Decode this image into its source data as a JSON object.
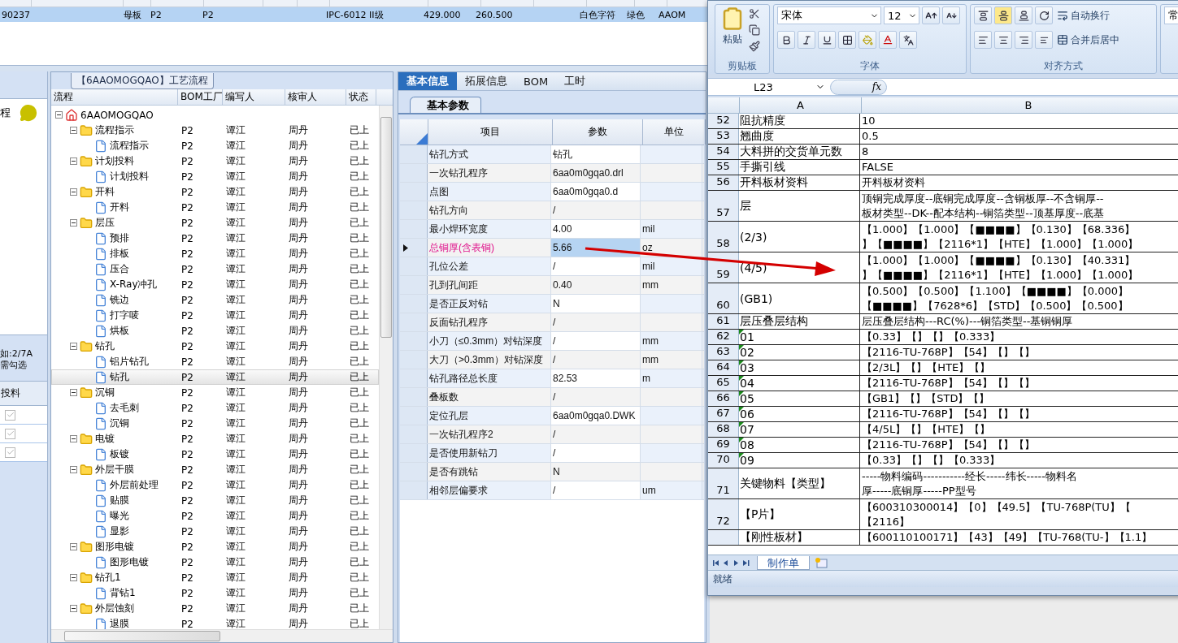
{
  "top_grid": {
    "rows": [
      {
        "selected": true,
        "cells": [
          "90237",
          "母板",
          "P2",
          "P2",
          "IPC-6012 II级",
          "429.000",
          "260.500",
          "白色字符",
          "绿色",
          "AAOM"
        ]
      }
    ]
  },
  "left_panel": {
    "heading": "程",
    "hint_lines": [
      "如:2/7A",
      "需勾选"
    ],
    "column": "投料",
    "rows": [
      {
        "checked": true,
        "disabled": true
      },
      {
        "checked": true,
        "disabled": true
      },
      {
        "checked": true,
        "disabled": true
      }
    ]
  },
  "process_tree": {
    "caption": "【6AAOMOGQAO】工艺流程",
    "columns": [
      "流程",
      "BOM工厂",
      "编写人",
      "核审人",
      "状态"
    ],
    "nodes": [
      {
        "label": "6AAOMOGQAO",
        "kind": "root",
        "expanded": true,
        "selected": false,
        "children": [
          {
            "label": "流程指示",
            "kind": "folder",
            "expanded": true,
            "selected": false,
            "factory": "P2",
            "writer": "谭江",
            "reviewer": "周丹",
            "status": "已上",
            "children": [
              {
                "label": "流程指示",
                "kind": "file",
                "selected": false,
                "factory": "P2",
                "writer": "谭江",
                "reviewer": "周丹",
                "status": "已上"
              }
            ]
          },
          {
            "label": "计划投料",
            "kind": "folder",
            "expanded": true,
            "selected": false,
            "factory": "P2",
            "writer": "谭江",
            "reviewer": "周丹",
            "status": "已上",
            "children": [
              {
                "label": "计划投料",
                "kind": "file",
                "selected": false,
                "factory": "P2",
                "writer": "谭江",
                "reviewer": "周丹",
                "status": "已上"
              }
            ]
          },
          {
            "label": "开料",
            "kind": "folder",
            "expanded": true,
            "selected": false,
            "factory": "P2",
            "writer": "谭江",
            "reviewer": "周丹",
            "status": "已上",
            "children": [
              {
                "label": "开料",
                "kind": "file",
                "selected": false,
                "factory": "P2",
                "writer": "谭江",
                "reviewer": "周丹",
                "status": "已上"
              }
            ]
          },
          {
            "label": "层压",
            "kind": "folder",
            "expanded": true,
            "selected": false,
            "factory": "P2",
            "writer": "谭江",
            "reviewer": "周丹",
            "status": "已上",
            "children": [
              {
                "label": "预排",
                "kind": "file",
                "selected": false,
                "factory": "P2",
                "writer": "谭江",
                "reviewer": "周丹",
                "status": "已上"
              },
              {
                "label": "排板",
                "kind": "file",
                "selected": false,
                "factory": "P2",
                "writer": "谭江",
                "reviewer": "周丹",
                "status": "已上"
              },
              {
                "label": "压合",
                "kind": "file",
                "selected": false,
                "factory": "P2",
                "writer": "谭江",
                "reviewer": "周丹",
                "status": "已上"
              },
              {
                "label": "X-Ray冲孔",
                "kind": "file",
                "selected": false,
                "factory": "P2",
                "writer": "谭江",
                "reviewer": "周丹",
                "status": "已上"
              },
              {
                "label": "铣边",
                "kind": "file",
                "selected": false,
                "factory": "P2",
                "writer": "谭江",
                "reviewer": "周丹",
                "status": "已上"
              },
              {
                "label": "打字唛",
                "kind": "file",
                "selected": false,
                "factory": "P2",
                "writer": "谭江",
                "reviewer": "周丹",
                "status": "已上"
              },
              {
                "label": "烘板",
                "kind": "file",
                "selected": false,
                "factory": "P2",
                "writer": "谭江",
                "reviewer": "周丹",
                "status": "已上"
              }
            ]
          },
          {
            "label": "钻孔",
            "kind": "folder",
            "expanded": true,
            "selected": false,
            "factory": "P2",
            "writer": "谭江",
            "reviewer": "周丹",
            "status": "已上",
            "children": [
              {
                "label": "铝片钻孔",
                "kind": "file",
                "selected": false,
                "factory": "P2",
                "writer": "谭江",
                "reviewer": "周丹",
                "status": "已上"
              },
              {
                "label": "钻孔",
                "kind": "file",
                "selected": true,
                "factory": "P2",
                "writer": "谭江",
                "reviewer": "周丹",
                "status": "已上"
              }
            ]
          },
          {
            "label": "沉铜",
            "kind": "folder",
            "expanded": true,
            "selected": false,
            "factory": "P2",
            "writer": "谭江",
            "reviewer": "周丹",
            "status": "已上",
            "children": [
              {
                "label": "去毛刺",
                "kind": "file",
                "selected": false,
                "factory": "P2",
                "writer": "谭江",
                "reviewer": "周丹",
                "status": "已上"
              },
              {
                "label": "沉铜",
                "kind": "file",
                "selected": false,
                "factory": "P2",
                "writer": "谭江",
                "reviewer": "周丹",
                "status": "已上"
              }
            ]
          },
          {
            "label": "电镀",
            "kind": "folder",
            "expanded": true,
            "selected": false,
            "factory": "P2",
            "writer": "谭江",
            "reviewer": "周丹",
            "status": "已上",
            "children": [
              {
                "label": "板镀",
                "kind": "file",
                "selected": false,
                "factory": "P2",
                "writer": "谭江",
                "reviewer": "周丹",
                "status": "已上"
              }
            ]
          },
          {
            "label": "外层干膜",
            "kind": "folder",
            "expanded": true,
            "selected": false,
            "factory": "P2",
            "writer": "谭江",
            "reviewer": "周丹",
            "status": "已上",
            "children": [
              {
                "label": "外层前处理",
                "kind": "file",
                "selected": false,
                "factory": "P2",
                "writer": "谭江",
                "reviewer": "周丹",
                "status": "已上"
              },
              {
                "label": "贴膜",
                "kind": "file",
                "selected": false,
                "factory": "P2",
                "writer": "谭江",
                "reviewer": "周丹",
                "status": "已上"
              },
              {
                "label": "曝光",
                "kind": "file",
                "selected": false,
                "factory": "P2",
                "writer": "谭江",
                "reviewer": "周丹",
                "status": "已上"
              },
              {
                "label": "显影",
                "kind": "file",
                "selected": false,
                "factory": "P2",
                "writer": "谭江",
                "reviewer": "周丹",
                "status": "已上"
              }
            ]
          },
          {
            "label": "图形电镀",
            "kind": "folder",
            "expanded": true,
            "selected": false,
            "factory": "P2",
            "writer": "谭江",
            "reviewer": "周丹",
            "status": "已上",
            "children": [
              {
                "label": "图形电镀",
                "kind": "file",
                "selected": false,
                "factory": "P2",
                "writer": "谭江",
                "reviewer": "周丹",
                "status": "已上"
              }
            ]
          },
          {
            "label": "钻孔1",
            "kind": "folder",
            "expanded": true,
            "selected": false,
            "factory": "P2",
            "writer": "谭江",
            "reviewer": "周丹",
            "status": "已上",
            "children": [
              {
                "label": "背钻1",
                "kind": "file",
                "selected": false,
                "factory": "P2",
                "writer": "谭江",
                "reviewer": "周丹",
                "status": "已上"
              }
            ]
          },
          {
            "label": "外层蚀刻",
            "kind": "folder",
            "expanded": true,
            "selected": false,
            "factory": "P2",
            "writer": "谭江",
            "reviewer": "周丹",
            "status": "已上",
            "children": [
              {
                "label": "退膜",
                "kind": "file",
                "selected": false,
                "factory": "P2",
                "writer": "谭江",
                "reviewer": "周丹",
                "status": "已上"
              }
            ]
          }
        ]
      }
    ]
  },
  "info_panel": {
    "tabs": [
      {
        "label": "基本信息",
        "selected": true
      },
      {
        "label": "拓展信息",
        "selected": false
      },
      {
        "label": "BOM",
        "selected": false
      },
      {
        "label": "工时",
        "selected": false
      }
    ],
    "subtabs": [
      {
        "label": "基本参数",
        "selected": true
      }
    ],
    "columns": [
      "项目",
      "参数",
      "单位"
    ],
    "rows": [
      {
        "item": "钻孔方式",
        "value": "钻孔",
        "selected": false
      },
      {
        "item": "一次钻孔程序",
        "value": "6aa0m0gqa0.drl",
        "selected": false
      },
      {
        "item": "点图",
        "value": "6aa0m0gqa0.d",
        "selected": false
      },
      {
        "item": "钻孔方向",
        "value": "/",
        "selected": false
      },
      {
        "item": "最小焊环宽度",
        "value": "4.00",
        "unit": "mil",
        "selected": false
      },
      {
        "item": "总铜厚(含表铜)",
        "value": "5.66",
        "unit": "oz",
        "selected": true
      },
      {
        "item": "孔位公差",
        "value": "/",
        "unit": "mil",
        "selected": false
      },
      {
        "item": "孔到孔间距",
        "value": "0.40",
        "unit": "mm",
        "selected": false
      },
      {
        "item": "是否正反对钻",
        "value": "N",
        "selected": false
      },
      {
        "item": "反面钻孔程序",
        "value": "/",
        "selected": false
      },
      {
        "item": "小刀（≤0.3mm）对钻深度",
        "value": "/",
        "unit": "mm",
        "selected": false
      },
      {
        "item": "大刀（>0.3mm）对钻深度",
        "value": "/",
        "unit": "mm",
        "selected": false
      },
      {
        "item": "钻孔路径总长度",
        "value": "82.53",
        "unit": "m",
        "selected": false
      },
      {
        "item": "叠板数",
        "value": "/",
        "selected": false
      },
      {
        "item": "定位孔层",
        "value": "6aa0m0gqa0.DWK",
        "selected": false
      },
      {
        "item": "一次钻孔程序2",
        "value": "/",
        "selected": false
      },
      {
        "item": "是否使用新钻刀",
        "value": "/",
        "selected": false
      },
      {
        "item": "是否有跳钻",
        "value": "N",
        "selected": false
      },
      {
        "item": "相邻层偏要求",
        "value": "/",
        "unit": "um",
        "selected": false
      }
    ]
  },
  "excel": {
    "ribbon": {
      "clipboard": {
        "paste": "粘贴",
        "label": "剪贴板"
      },
      "font": {
        "name": "宋体",
        "size": "12",
        "label": "字体"
      },
      "alignment": {
        "wrap": "自动换行",
        "merge": "合并后居中",
        "label": "对齐方式"
      },
      "number": {
        "format": "常"
      }
    },
    "formula_bar": {
      "cell": "L23",
      "function_label": "fx"
    },
    "columns": [
      "A",
      "B"
    ],
    "rows": [
      {
        "num": "52",
        "a": "阻抗精度",
        "b": [
          "10"
        ]
      },
      {
        "num": "53",
        "a": "翘曲度",
        "b": [
          "0.5"
        ]
      },
      {
        "num": "54",
        "a": "大料拼的交货单元数",
        "b": [
          "8"
        ]
      },
      {
        "num": "55",
        "a": "手撕引线",
        "b": [
          "FALSE"
        ]
      },
      {
        "num": "56",
        "a": "开料板材资料",
        "b": [
          "开料板材资料"
        ]
      },
      {
        "num": "57",
        "a": "层",
        "b": [
          "顶铜完成厚度--底铜完成厚度--含铜板厚--不含铜厚--",
          "板材类型--DK--配本结构--铜箔类型--顶基厚度--底基"
        ]
      },
      {
        "num": "58",
        "a": "(2/3)",
        "b": [
          "【1.000】【1.000】【■■■■】【0.130】【68.336】",
          "】【■■■■】【2116*1】【HTE】【1.000】【1.000】"
        ]
      },
      {
        "num": "59",
        "a": "(4/5)",
        "b": [
          "【1.000】【1.000】【■■■■】【0.130】【40.331】",
          "】【■■■■】【2116*1】【HTE】【1.000】【1.000】"
        ]
      },
      {
        "num": "60",
        "a": "(GB1)",
        "b": [
          "【0.500】【0.500】【1.100】【■■■■】【0.000】",
          "【■■■■】【7628*6】【STD】【0.500】【0.500】"
        ]
      },
      {
        "num": "61",
        "a": "层压叠层结构",
        "b": [
          "层压叠层结构---RC(%)---铜箔类型--基铜铜厚"
        ]
      },
      {
        "num": "62",
        "a": "01",
        "text_number": true,
        "b": [
          "【0.33】【】【】【0.333】"
        ]
      },
      {
        "num": "63",
        "a": "02",
        "text_number": true,
        "b": [
          "【2116-TU-768P】【54】【】【】"
        ]
      },
      {
        "num": "64",
        "a": "03",
        "text_number": true,
        "b": [
          "【2/3L】【】【HTE】【】"
        ]
      },
      {
        "num": "65",
        "a": "04",
        "text_number": true,
        "b": [
          "【2116-TU-768P】【54】【】【】"
        ]
      },
      {
        "num": "66",
        "a": "05",
        "text_number": true,
        "b": [
          "【GB1】【】【STD】【】"
        ]
      },
      {
        "num": "67",
        "a": "06",
        "text_number": true,
        "b": [
          "【2116-TU-768P】【54】【】【】"
        ]
      },
      {
        "num": "68",
        "a": "07",
        "text_number": true,
        "b": [
          "【4/5L】【】【HTE】【】"
        ]
      },
      {
        "num": "69",
        "a": "08",
        "text_number": true,
        "b": [
          "【2116-TU-768P】【54】【】【】"
        ]
      },
      {
        "num": "70",
        "a": "09",
        "text_number": true,
        "b": [
          "【0.33】【】【】【0.333】"
        ]
      },
      {
        "num": "71",
        "a": "关键物料【类型】",
        "b": [
          "-----物料编码-----------经长-----纬长-----物料名",
          "厚-----底铜厚-----PP型号"
        ]
      },
      {
        "num": "72",
        "a": "【P片】",
        "b": [
          "【600310300014】【0】【49.5】【TU-768P(TU】【",
          "【2116】"
        ]
      },
      {
        "a": "【刚性板材】",
        "b": [
          "【600110100171】【43】【49】【TU-768(TU-】【1.1】"
        ]
      }
    ],
    "sheets": [
      {
        "label": "制作单",
        "selected": true
      }
    ],
    "status": "就绪"
  }
}
